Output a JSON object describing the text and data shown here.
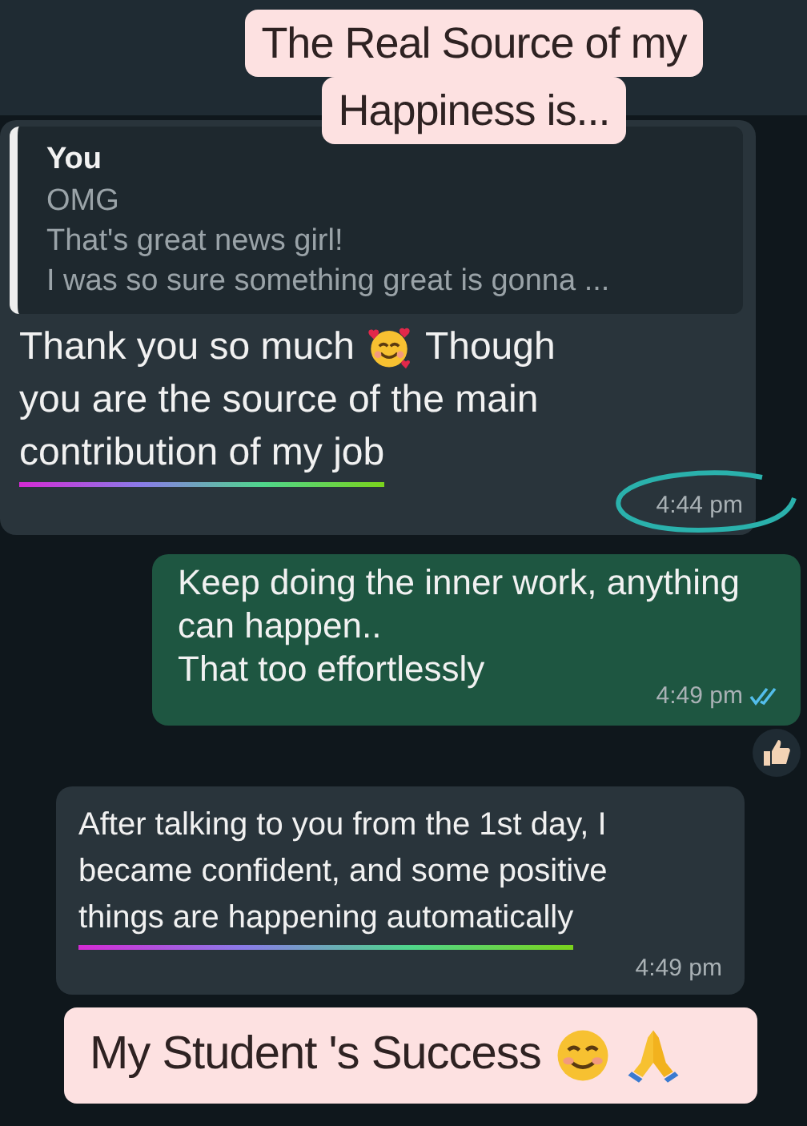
{
  "top_caption": {
    "lines": [
      "The Real Source of my",
      "Happiness is..."
    ]
  },
  "messages": [
    {
      "kind": "received",
      "quote": {
        "author": "You",
        "lines": [
          "OMG",
          "That's great news girl!",
          "I was so sure something great is gonna ..."
        ]
      },
      "time": "4:44 pm",
      "time_circled": true,
      "reacted": false,
      "lines": [
        [
          {
            "text": "Thank you so much",
            "underlined": false
          },
          {
            "kind": "hearts-face"
          },
          {
            "text": "Though",
            "underlined": false
          }
        ],
        [
          {
            "text": "you are the source of the main",
            "underlined": false
          }
        ],
        [
          {
            "text": "contribution of my job",
            "underlined": true
          }
        ]
      ]
    },
    {
      "kind": "sent",
      "time": "4:49 pm",
      "time_circled": false,
      "read": true,
      "reacted": true,
      "lines": [
        [
          {
            "text": "Keep doing the inner work, anything",
            "underlined": false
          }
        ],
        [
          {
            "text": "can happen..",
            "underlined": false
          }
        ],
        [
          {
            "text": "That too effortlessly",
            "underlined": false
          }
        ]
      ]
    },
    {
      "kind": "received",
      "time": "4:49 pm",
      "time_circled": false,
      "reacted": false,
      "lines": [
        [
          {
            "text": "After talking to you from the 1st day, I",
            "underlined": false
          }
        ],
        [
          {
            "text": "became confident, and some positive",
            "underlined": false
          }
        ],
        [
          {
            "text": "things are happening automatically",
            "underlined": true
          }
        ]
      ]
    }
  ],
  "bottom_caption": {
    "parts": [
      {
        "text": "My Student 's Success"
      },
      {
        "kind": "smile-face"
      },
      {
        "kind": "folded-hands"
      }
    ]
  }
}
